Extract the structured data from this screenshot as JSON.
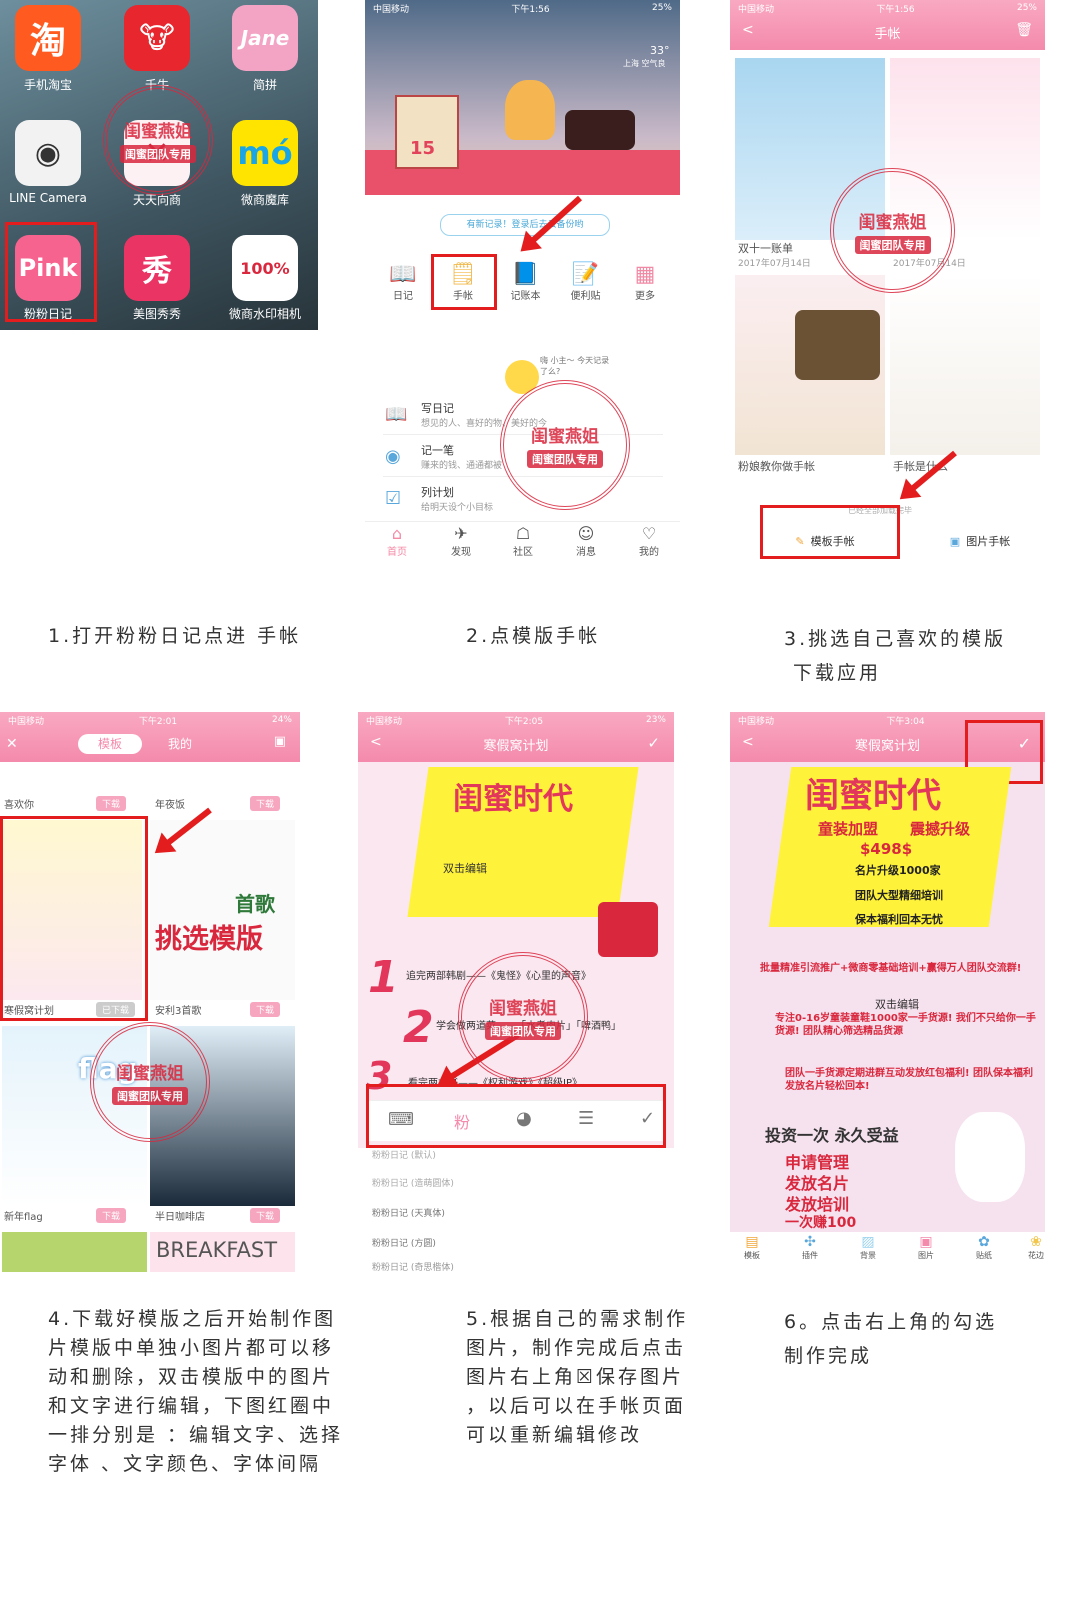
{
  "panel1": {
    "apps": [
      "手机淘宝",
      "千牛",
      "简拼",
      "LINE Camera",
      "天天向商",
      "微商魔库",
      "粉粉日记",
      "美图秀秀",
      "微商水印相机"
    ],
    "icon_text": {
      "taobao": "淘",
      "jane": "Jane",
      "mo": "mó",
      "pink": "Pink",
      "xiu": "秀",
      "stamp": "100%"
    }
  },
  "panel2": {
    "status_left": "中国移动",
    "status_time": "下午1:56",
    "status_right": "25%",
    "weather_temp": "33°",
    "weather_city": "上海  空气良",
    "calendar_day": "15",
    "banner_text": "有新记录！登录后去云备份哟",
    "menu": [
      "日记",
      "手帐",
      "记账本",
      "便利贴",
      "更多"
    ],
    "mascot_text": "嗨 小主～ 今天记录了么?",
    "list": [
      {
        "title": "写日记",
        "desc": "想见的人、喜好的物、美好的今"
      },
      {
        "title": "记一笔",
        "desc": "赚来的钱、通通都被"
      },
      {
        "title": "列计划",
        "desc": "给明天设个小目标"
      }
    ],
    "tabs": [
      "首页",
      "发现",
      "社区",
      "消息",
      "我的"
    ]
  },
  "panel3": {
    "status_left": "中国移动",
    "status_time": "下午1:56",
    "status_right": "25%",
    "title": "手帐",
    "cards": [
      {
        "title": "双十一账单",
        "date": "2017年07月14日"
      },
      {
        "title": "",
        "date": "2017年07月14日"
      },
      {
        "title": "粉娘教你做手帐",
        "date": ""
      },
      {
        "title": "手帐是什么",
        "date": ""
      }
    ],
    "bottom_hint": "已经全部加载完毕",
    "buttons": [
      "模板手帐",
      "图片手帐"
    ]
  },
  "panel4": {
    "status_left": "中国移动",
    "status_time": "下午2:01",
    "status_right": "24%",
    "tabs": [
      "模板",
      "我的"
    ],
    "items": [
      "喜欢你",
      "年夜饭",
      "寒假窝计划",
      "安利3首歌",
      "新年flag",
      "半日咖啡店"
    ],
    "download": "下载",
    "downloaded": "已下载",
    "overlay_title": "挑选模版",
    "overlay_small": "首歌",
    "breakfast": "BREAKFAST",
    "flag_text": "flag"
  },
  "panel5": {
    "status_left": "中国移动",
    "status_time": "下午2:05",
    "status_right": "23%",
    "title": "寒假窝计划",
    "heading": "闺蜜时代",
    "edit_hint": "双击编辑",
    "numbered": [
      {
        "n": "1",
        "text": "追完两部韩剧——《鬼怪》《心里的声音》"
      },
      {
        "n": "2",
        "text": "学会做两道菜——「水煮肉片」「啤酒鸭」"
      },
      {
        "n": "3",
        "text": "看完两本书——《权利游戏》《超级IP》"
      }
    ],
    "pink_char": "粉",
    "fonts": [
      "粉粉日记  (默认)",
      "粉粉日记  (造萌圆体)",
      "粉粉日记  (天真体)",
      "粉粉日记  (方圆)",
      "粉粉日记  (奇思楷体)"
    ]
  },
  "panel6": {
    "status_left": "中国移动",
    "status_time": "下午3:04",
    "title": "寒假窝计划",
    "heading": "闺蜜时代",
    "sub_left": "童装加盟",
    "sub_right": "震撼升级",
    "price": "$498$",
    "bullets": [
      "名片升级1000家",
      "团队大型精细培训",
      "保本福利回本无忧"
    ],
    "edit_hint": "双击编辑",
    "lines": [
      "批量精准引流推广+微商零基础培训+赢得万人团队交流群!",
      "专注0-16岁童装童鞋1000家一手货源! 我们不只给你一手货源! 团队精心筛选精品货源",
      "团队一手货源定期进群互动发放红包福利! 团队保本福利发放名片轻松回本!"
    ],
    "slogan": "投资一次  永久受益",
    "list2": [
      "申请管理",
      "发放名片",
      "发放培训",
      "一次赚100"
    ],
    "tabs": [
      "模板",
      "插件",
      "背景",
      "图片",
      "贴纸",
      "花边"
    ]
  },
  "seal": {
    "text": "闺蜜燕姐",
    "sub": "闺蜜团队专用"
  },
  "captions": [
    "1.打开粉粉日记点进 手帐",
    "2.点模版手帐",
    "3.挑选自己喜欢的模版\n 下载应用",
    "4.下载好模版之后开始制作图\n片模版中单独小图片都可以移\n动和删除，双击模版中的图片\n和文字进行编辑，下图红圈中\n一排分别是 ：编辑文字、选择\n字体 、文字颜色、字体间隔",
    "5.根据自己的需求制作\n图片，制作完成后点击\n图片右上角☒保存图片\n，以后可以在手帐页面\n可以重新编辑修改",
    "6。点击右上角的勾选\n制作完成"
  ]
}
